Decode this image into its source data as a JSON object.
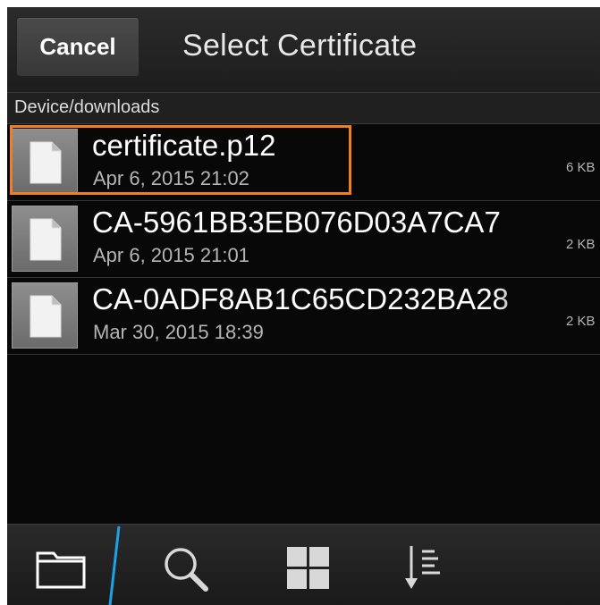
{
  "header": {
    "cancel_label": "Cancel",
    "title": "Select Certificate"
  },
  "path": "Device/downloads",
  "files": [
    {
      "name": "certificate.p12",
      "date": "Apr 6, 2015 21:02",
      "size": "6 KB",
      "selected": true
    },
    {
      "name": "CA-5961BB3EB076D03A7CA7",
      "date": "Apr 6, 2015 21:01",
      "size": "2 KB",
      "selected": false
    },
    {
      "name": "CA-0ADF8AB1C65CD232BA28",
      "date": "Mar 30, 2015 18:39",
      "size": "2 KB",
      "selected": false
    }
  ],
  "action_bar": {
    "items": [
      "folder-icon",
      "search-icon",
      "grid-view-icon",
      "sort-icon"
    ],
    "active": "folder-icon"
  },
  "colors": {
    "selection": "#f07f1e",
    "active_indicator": "#1aa3e8",
    "background": "#080808"
  }
}
